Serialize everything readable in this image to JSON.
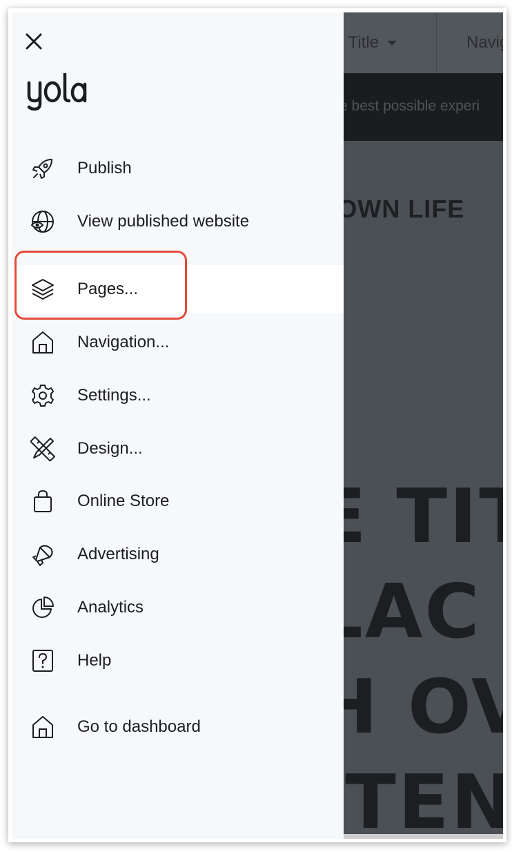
{
  "background": {
    "tab_title": "e Title",
    "tab_nav": "Navig",
    "banner_text": "e the best possible experi",
    "town_text": "TOWN LIFE",
    "big_lines": [
      "E TIT",
      "LAC",
      "H OV",
      "ITEN"
    ]
  },
  "drawer": {
    "logo_text": "yola",
    "close_label": "Close",
    "menu": [
      {
        "label": "Publish",
        "icon": "rocket-icon"
      },
      {
        "label": "View published website",
        "icon": "globe-eye-icon"
      },
      {
        "label": "Pages...",
        "icon": "layers-icon",
        "active": true
      },
      {
        "label": "Navigation...",
        "icon": "home-icon"
      },
      {
        "label": "Settings...",
        "icon": "gear-icon"
      },
      {
        "label": "Design...",
        "icon": "pencil-ruler-icon"
      },
      {
        "label": "Online Store",
        "icon": "shopping-bag-icon"
      },
      {
        "label": "Advertising",
        "icon": "megaphone-icon"
      },
      {
        "label": "Analytics",
        "icon": "pie-chart-icon"
      },
      {
        "label": "Help",
        "icon": "question-icon"
      }
    ],
    "dashboard": {
      "label": "Go to dashboard",
      "icon": "home-icon"
    }
  },
  "colors": {
    "highlight": "#e44a3a",
    "drawer_bg": "#f7f8fa",
    "active_bg": "#ffffff",
    "text": "#1b1d20"
  }
}
